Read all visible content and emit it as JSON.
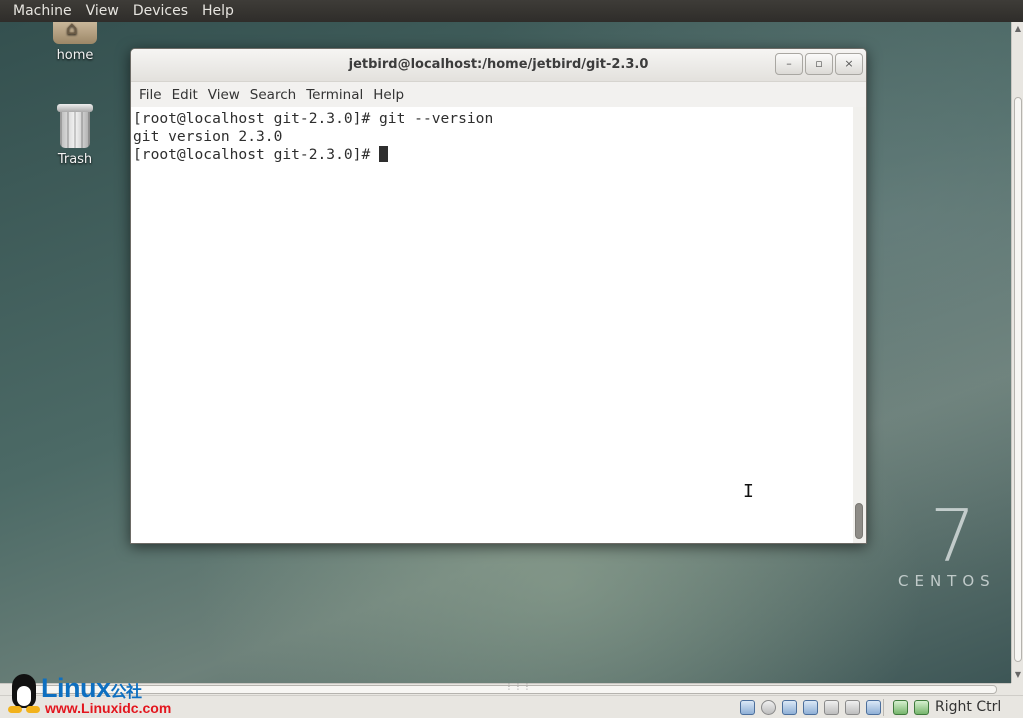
{
  "vbox_menu": [
    "Machine",
    "View",
    "Devices",
    "Help"
  ],
  "desktop": {
    "icons": [
      {
        "label": "home",
        "icon": "home-folder-icon"
      },
      {
        "label": "Trash",
        "icon": "trash-icon"
      }
    ],
    "branding": {
      "number": "7",
      "word": "CENTOS"
    }
  },
  "terminal": {
    "title": "jetbird@localhost:/home/jetbird/git-2.3.0",
    "window_buttons": {
      "minimize": "–",
      "maximize": "▫",
      "close": "×"
    },
    "menu": [
      "File",
      "Edit",
      "View",
      "Search",
      "Terminal",
      "Help"
    ],
    "lines": [
      "[root@localhost git-2.3.0]# git --version",
      "git version 2.3.0",
      "[root@localhost git-2.3.0]# "
    ]
  },
  "statusbar": {
    "host_key": "Right Ctrl",
    "icons": [
      "hard-disk-icon",
      "optical-drive-icon",
      "usb-icon",
      "network-icon",
      "shared-folder-icon",
      "display-icon",
      "video-capture-icon",
      "virtualization-icon",
      "mouse-integration-icon"
    ]
  },
  "watermark": {
    "name": "Linux",
    "name_cn": "公社",
    "url": "www.Linuxidc.com"
  }
}
